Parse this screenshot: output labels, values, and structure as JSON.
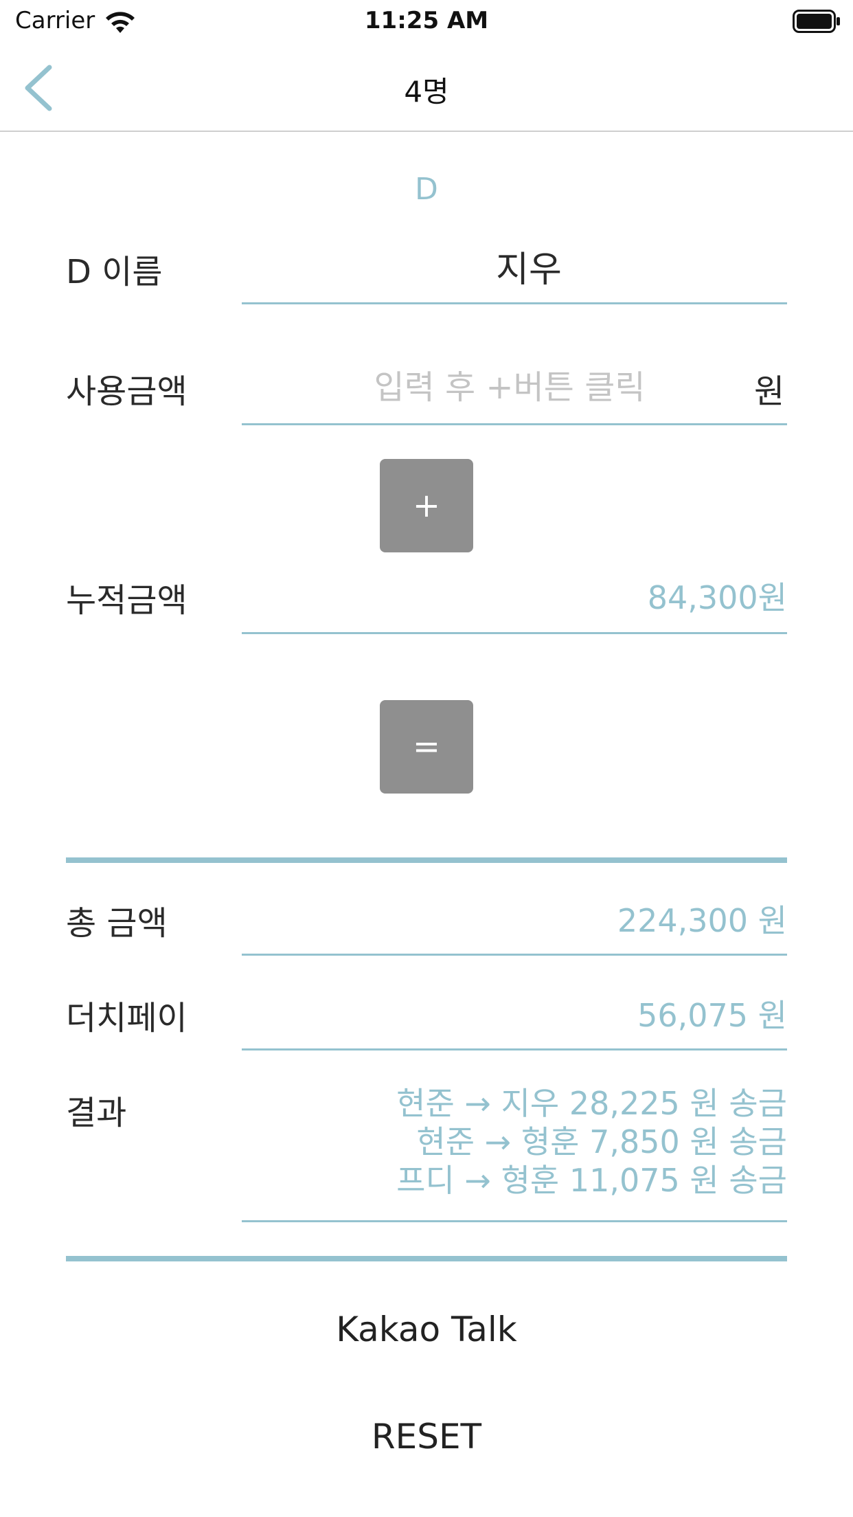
{
  "status_bar": {
    "carrier": "Carrier",
    "time": "11:25 AM",
    "icons": [
      "wifi-icon",
      "battery-icon"
    ]
  },
  "nav": {
    "title": "4명",
    "back_icon": "chevron-left-icon"
  },
  "form": {
    "section_title": "D",
    "name_label": "D 이름",
    "name_value": "지우",
    "amount_label": "사용금액",
    "amount_value": "",
    "amount_placeholder": "입력 후 +버튼 클릭",
    "amount_unit": "원",
    "plus_label": "+",
    "cumulative_label": "누적금액",
    "cumulative_value": "84,300원",
    "equals_label": "="
  },
  "summary": {
    "total_label": "총 금액",
    "total_value": "224,300 원",
    "dutch_label": "더치페이",
    "dutch_value": "56,075 원",
    "result_label": "결과",
    "result_lines": [
      "현준 → 지우 28,225 원 송금",
      "현준 → 형훈 7,850 원 송금",
      "프디 → 형훈 11,075 원 송금"
    ]
  },
  "actions": {
    "kakao_label": "Kakao Talk",
    "reset_label": "RESET"
  },
  "colors": {
    "accent": "#94c2cf",
    "button_gray": "#8f8f8f",
    "text": "#2a2a2a"
  }
}
